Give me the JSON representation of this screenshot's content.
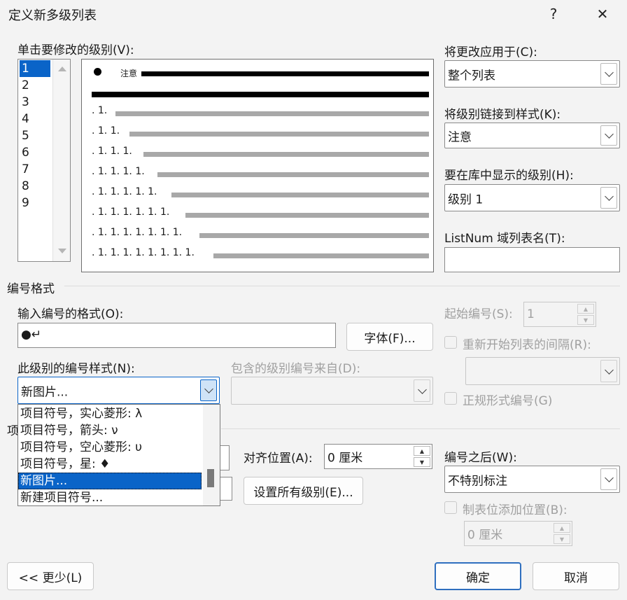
{
  "window": {
    "title": "定义新多级列表",
    "help": "?",
    "close": "✕"
  },
  "levels": {
    "label": "单击要修改的级别(V):",
    "items": [
      "1",
      "2",
      "3",
      "4",
      "5",
      "6",
      "7",
      "8",
      "9"
    ],
    "selected_index": 0
  },
  "preview": {
    "first_label": "注意",
    "rows": [
      ". 1.",
      ". 1. 1.",
      ". 1. 1. 1.",
      ". 1. 1. 1. 1.",
      ". 1. 1. 1. 1. 1.",
      ". 1. 1. 1. 1. 1. 1.",
      ". 1. 1. 1. 1. 1. 1. 1.",
      ". 1. 1. 1. 1. 1. 1. 1. 1."
    ]
  },
  "right_panel": {
    "apply_label": "将更改应用于(C):",
    "apply_value": "整个列表",
    "link_style_label": "将级别链接到样式(K):",
    "link_style_value": "注意",
    "gallery_level_label": "要在库中显示的级别(H):",
    "gallery_level_value": "级别 1",
    "listnum_label": "ListNum 域列表名(T):",
    "listnum_value": ""
  },
  "number_format": {
    "section_title": "编号格式",
    "format_label": "输入编号的格式(O):",
    "format_value": "●↵",
    "font_button": "字体(F)...",
    "style_label": "此级别的编号样式(N):",
    "style_value": "新图片...",
    "include_label": "包含的级别编号来自(D):",
    "include_value": "",
    "start_label": "起始编号(S):",
    "start_value": "1",
    "restart_label": "重新开始列表的间隔(R):",
    "restart_value": "",
    "legal_label": "正规形式编号(G)"
  },
  "dropdown": {
    "items": [
      "项目符号，实心菱形: λ",
      "项目符号，箭头: ν",
      "项目符号，空心菱形: υ",
      "项目符号，星: ♦",
      "新图片...",
      "新建项目符号..."
    ],
    "selected_index": 4
  },
  "position": {
    "section_partial": "项",
    "align_at_label": "对齐位置(A):",
    "align_at_value": "0 厘米",
    "set_all_button": "设置所有级别(E)...",
    "follow_label": "编号之后(W):",
    "follow_value": "不特别标注",
    "tab_stop_label": "制表位添加位置(B):",
    "tab_stop_value": "0 厘米"
  },
  "footer": {
    "less_button": "<< 更少(L)",
    "ok_button": "确定",
    "cancel_button": "取消"
  }
}
